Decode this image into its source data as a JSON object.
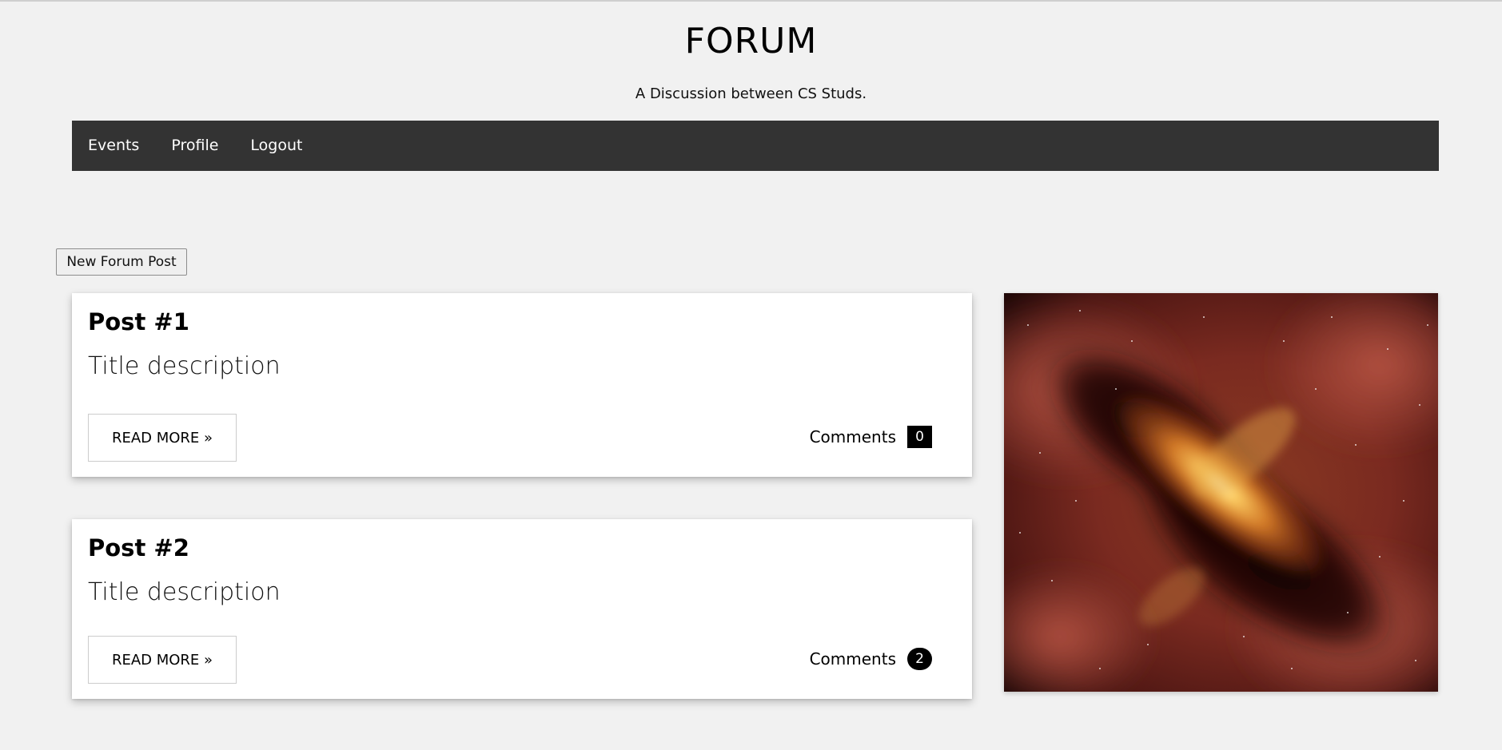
{
  "header": {
    "title": "FORUM",
    "subtitle": "A Discussion between CS Studs."
  },
  "nav": {
    "items": [
      {
        "label": "Events"
      },
      {
        "label": "Profile"
      },
      {
        "label": "Logout"
      }
    ]
  },
  "actions": {
    "new_post_label": "New Forum Post"
  },
  "posts": [
    {
      "title": "Post #1",
      "description": "Title description",
      "read_more_label": "READ MORE »",
      "comments_label": "Comments",
      "comments_count": "0"
    },
    {
      "title": "Post #2",
      "description": "Title description",
      "read_more_label": "READ MORE »",
      "comments_label": "Comments",
      "comments_count": "2"
    }
  ],
  "colors": {
    "background": "#f1f1f1",
    "navbar": "#333333",
    "badge": "#000000"
  }
}
